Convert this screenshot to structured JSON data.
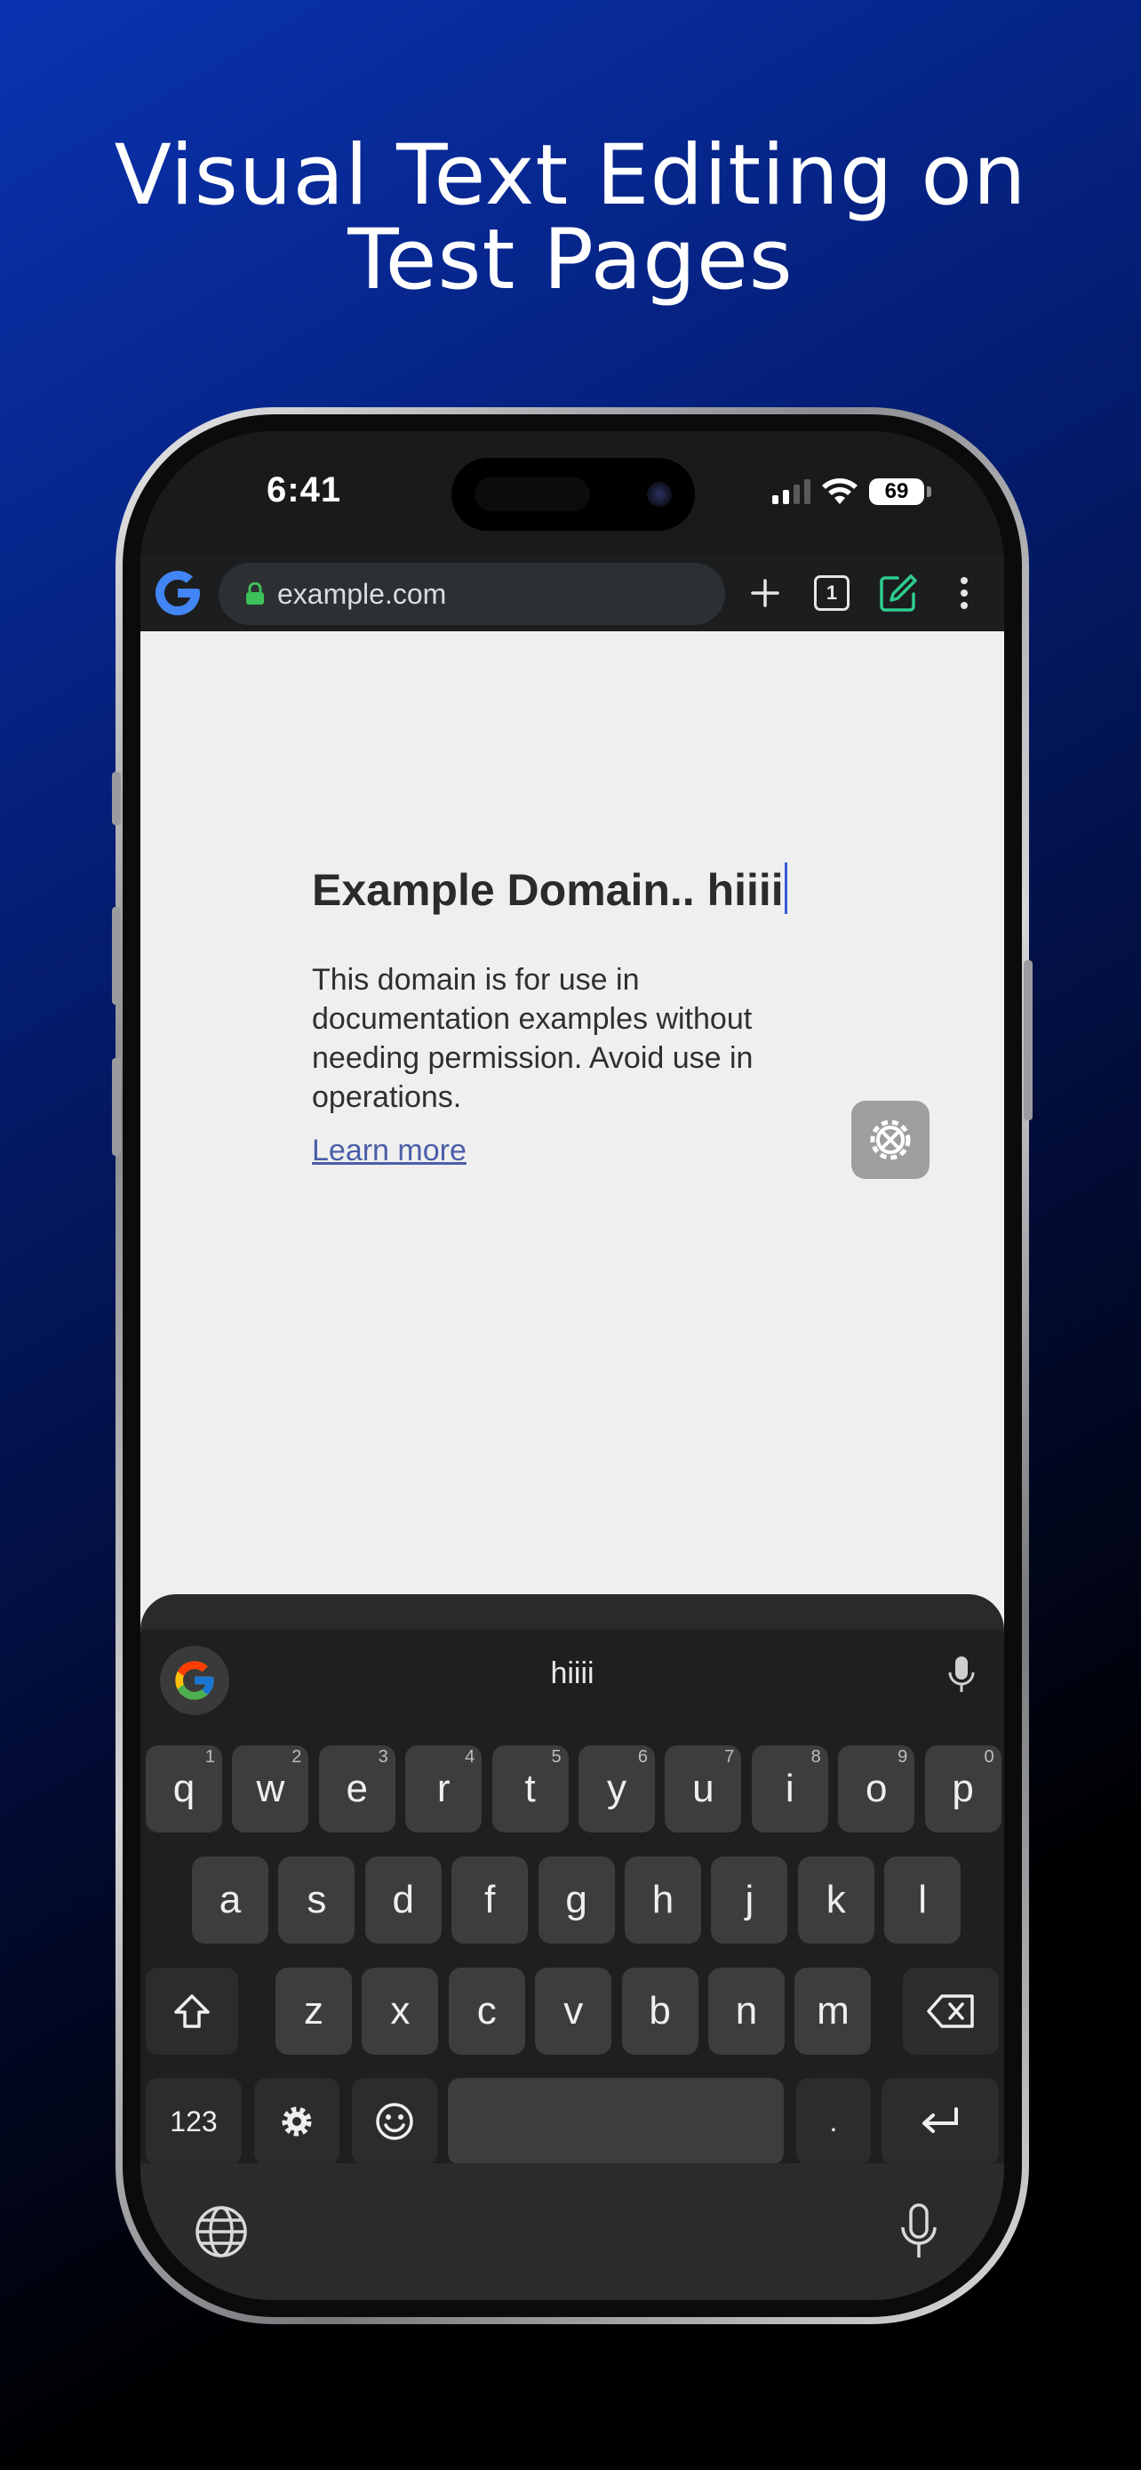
{
  "headline": {
    "line1": "Visual Text Editing on",
    "line2": "Test Pages"
  },
  "status_bar": {
    "time": "6:41",
    "battery": "69"
  },
  "browser": {
    "url": "example.com",
    "tab_count": "1"
  },
  "page": {
    "title": "Example Domain.. hiiii",
    "body": "This domain is for use in documentation examples without needing permission. Avoid use in operations.",
    "link": "Learn more"
  },
  "keyboard": {
    "suggestion": "hiiii",
    "row1": [
      {
        "k": "q",
        "n": "1"
      },
      {
        "k": "w",
        "n": "2"
      },
      {
        "k": "e",
        "n": "3"
      },
      {
        "k": "r",
        "n": "4"
      },
      {
        "k": "t",
        "n": "5"
      },
      {
        "k": "y",
        "n": "6"
      },
      {
        "k": "u",
        "n": "7"
      },
      {
        "k": "i",
        "n": "8"
      },
      {
        "k": "o",
        "n": "9"
      },
      {
        "k": "p",
        "n": "0"
      }
    ],
    "row2": [
      "a",
      "s",
      "d",
      "f",
      "g",
      "h",
      "j",
      "k",
      "l"
    ],
    "row3": [
      "z",
      "x",
      "c",
      "v",
      "b",
      "n",
      "m"
    ],
    "numbers_key": "123",
    "period_key": "."
  },
  "colors": {
    "accent_green": "#2ecc8f",
    "caret_blue": "#3b5bdb",
    "link_blue": "#4b5ea8"
  },
  "icons": [
    "google-logo-icon",
    "lock-icon",
    "plus-icon",
    "tab-switcher-icon",
    "edit-icon",
    "overflow-menu-icon",
    "settings-tools-icon",
    "microphone-icon",
    "shift-icon",
    "backspace-icon",
    "gear-icon",
    "emoji-icon",
    "enter-icon",
    "globe-icon"
  ]
}
